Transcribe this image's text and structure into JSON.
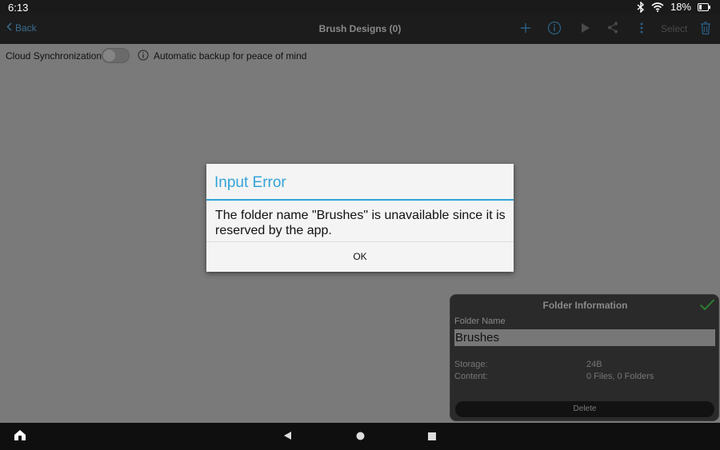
{
  "status_bar": {
    "time": "6:13",
    "battery": "18%"
  },
  "toolbar": {
    "back_label": "Back",
    "title": "Brush Designs (0)",
    "select_label": "Select"
  },
  "sync": {
    "label": "Cloud Synchronization",
    "enabled": false,
    "description": "Automatic backup for peace of mind"
  },
  "dialog": {
    "title": "Input Error",
    "message": "The folder name \"Brushes\" is unavailable since it is reserved by the app.",
    "ok_label": "OK"
  },
  "folder_info": {
    "title": "Folder Information",
    "name_label": "Folder Name",
    "name_value": "Brushes",
    "storage_label": "Storage:",
    "storage_value": "24B",
    "content_label": "Content:",
    "content_value": "0 Files, 0 Folders",
    "delete_label": "Delete"
  },
  "colors": {
    "accent": "#33a3d8",
    "toolbar_icon": "#2a5f85",
    "dim_overlay": "#7a7a7a"
  }
}
